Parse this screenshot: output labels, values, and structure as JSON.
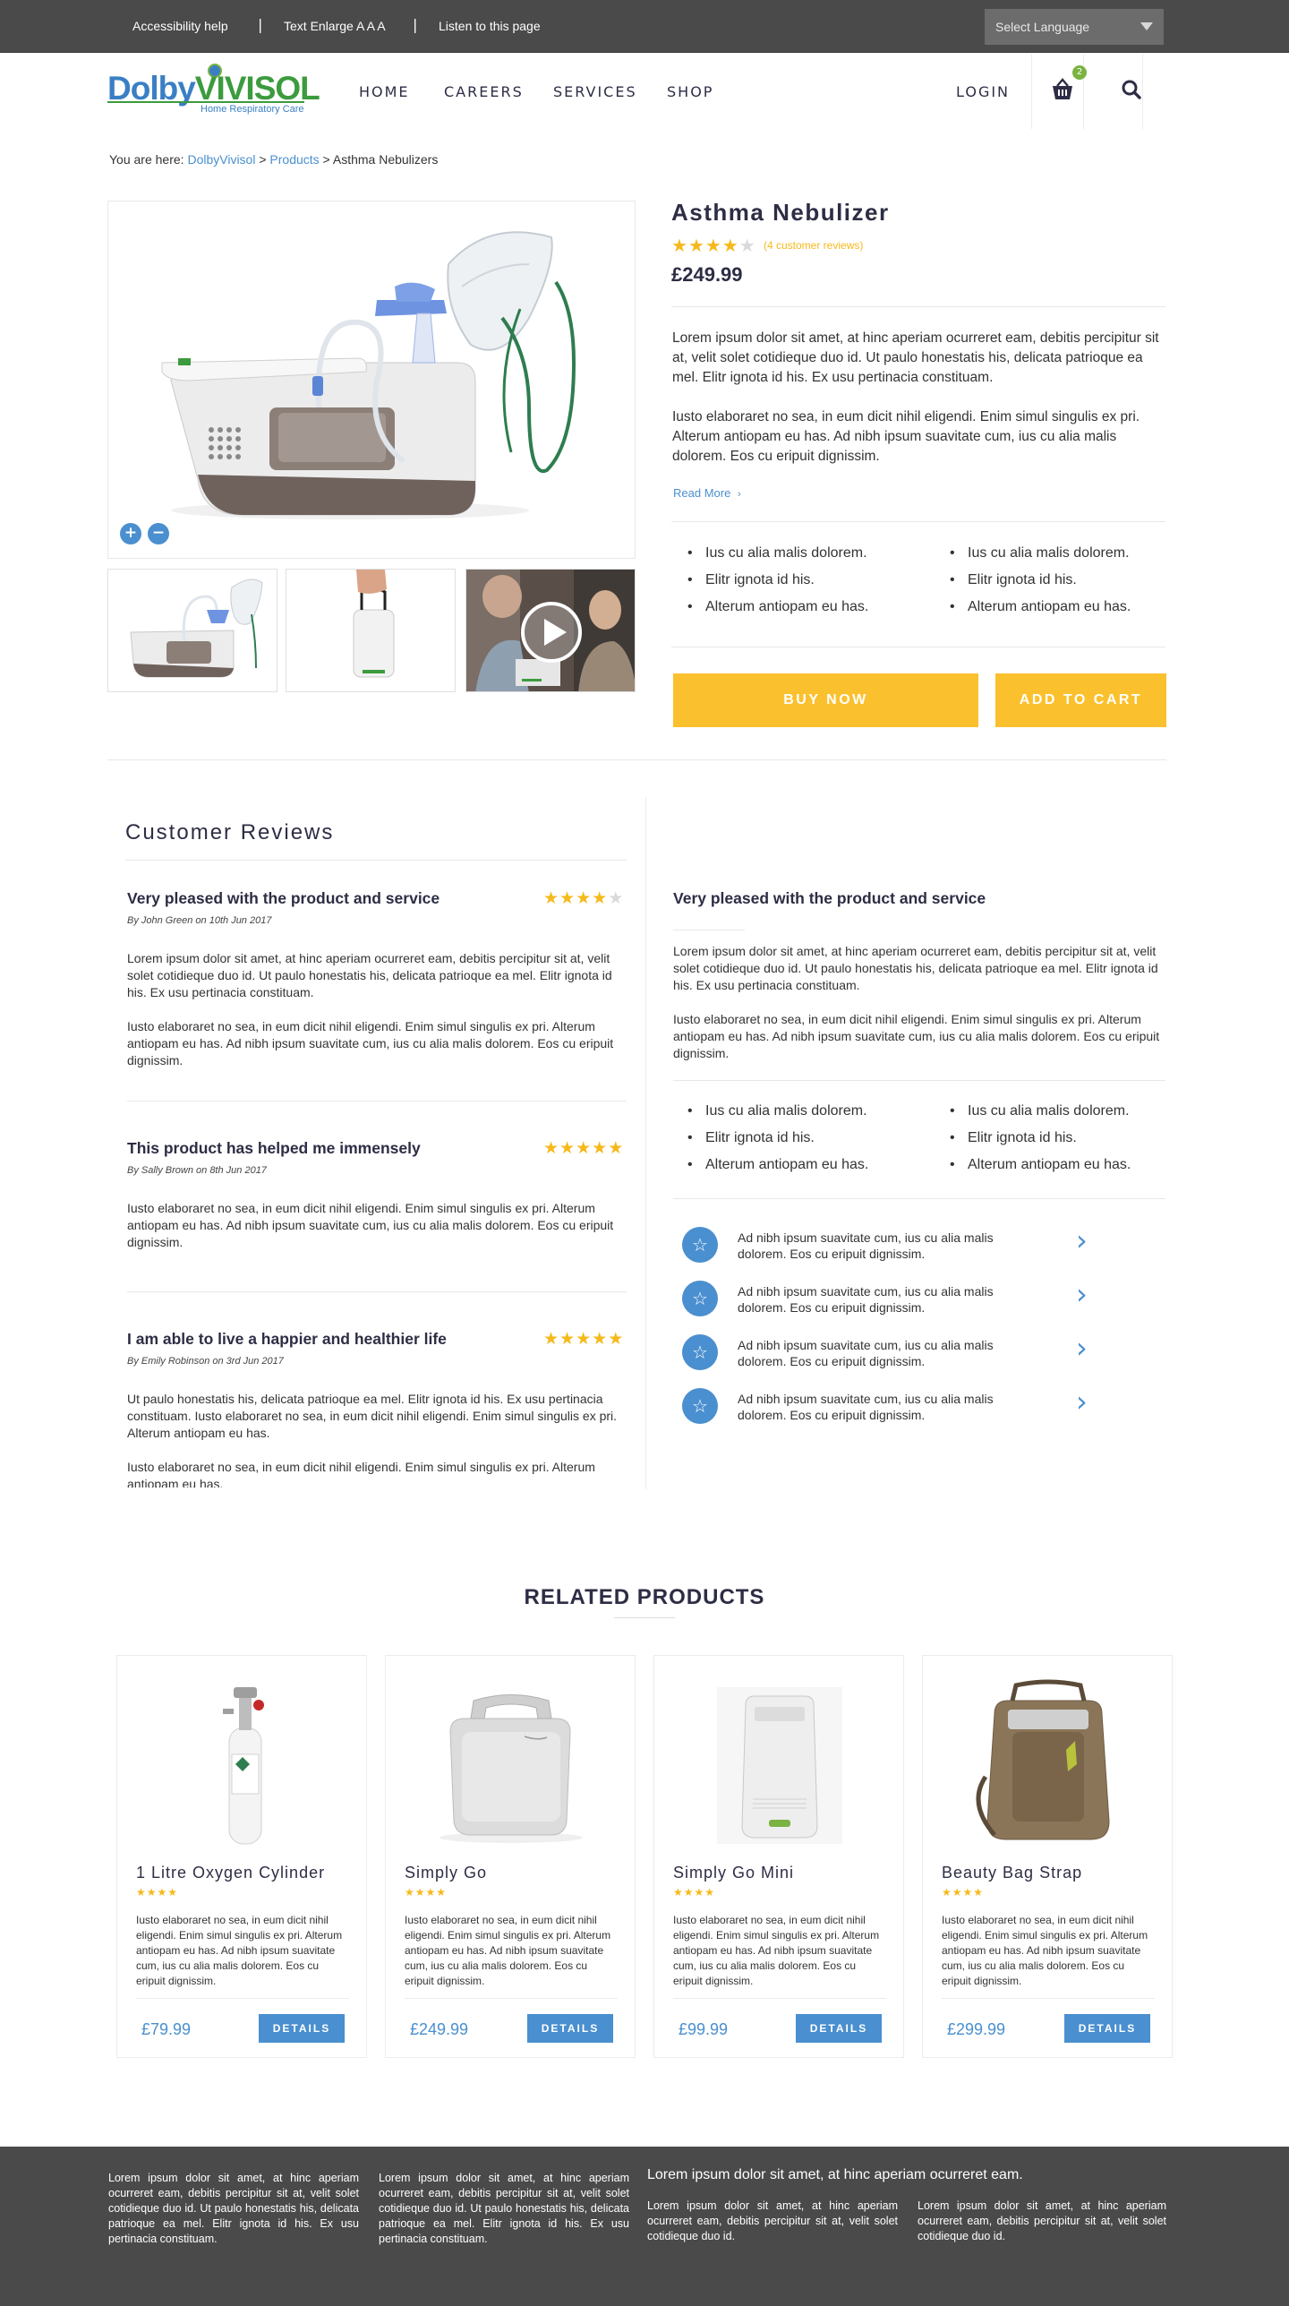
{
  "topbar": {
    "accessibility": "Accessibility help",
    "text_enlarge": "Text Enlarge A A A",
    "listen": "Listen to this page",
    "separator": "|",
    "language": "Select Language"
  },
  "logo": {
    "dolby": "Dolby",
    "vivisol": "VIVISOL",
    "tagline": "Home Respiratory Care"
  },
  "nav": {
    "home": "HOME",
    "careers": "CAREERS",
    "services": "SERVICES",
    "shop": "SHOP",
    "login": "LOGIN",
    "cart_count": "2"
  },
  "breadcrumb": {
    "prefix": "You are here: ",
    "home": "DolbyVivisol",
    "sep": " > ",
    "products": "Products",
    "current": "Asthma Nebulizers"
  },
  "product": {
    "title": "Asthma Nebulizer",
    "rating": 4,
    "reviews_label": "(4 customer reviews)",
    "price": "£249.99",
    "desc1": "Lorem ipsum dolor sit amet, at hinc aperiam ocurreret eam, debitis percipitur sit at, velit solet cotidieque duo id. Ut paulo honestatis his, delicata patrioque ea mel. Elitr ignota id his. Ex usu pertinacia constituam.",
    "desc2": "Iusto elaboraret no sea, in eum dicit nihil eligendi. Enim simul singulis ex pri. Alterum antiopam eu has. Ad nibh ipsum suavitate cum, ius cu alia malis dolorem. Eos cu eripuit dignissim.",
    "read_more": "Read More",
    "bullets_left": [
      "Ius cu alia malis dolorem.",
      "Elitr ignota id his.",
      "Alterum antiopam eu has."
    ],
    "bullets_right": [
      "Ius cu alia malis dolorem.",
      "Elitr ignota id his.",
      "Alterum antiopam eu has."
    ],
    "buy_now": "BUY NOW",
    "add_to_cart": "ADD TO CART",
    "zoom_in": "+",
    "zoom_out": "−"
  },
  "reviews": {
    "title": "Customer Reviews",
    "items": [
      {
        "headline": "Very pleased with the product and service",
        "rating": 4,
        "by": "By John Green on 10th Jun 2017",
        "p1": "Lorem ipsum dolor sit amet, at hinc aperiam ocurreret eam, debitis percipitur sit at, velit solet cotidieque duo id. Ut paulo honestatis his, delicata patrioque ea mel. Elitr ignota id his. Ex usu pertinacia constituam.",
        "p2": "Iusto elaboraret no sea, in eum dicit nihil eligendi. Enim simul singulis ex pri. Alterum antiopam eu has. Ad nibh ipsum suavitate cum, ius cu alia malis dolorem. Eos cu eripuit dignissim."
      },
      {
        "headline": "This product has helped me immensely",
        "rating": 5,
        "by": "By Sally Brown on 8th Jun 2017",
        "p1": "Iusto elaboraret no sea, in eum dicit nihil eligendi. Enim simul singulis ex pri. Alterum antiopam eu has. Ad nibh ipsum suavitate cum, ius cu alia malis dolorem. Eos cu eripuit dignissim."
      },
      {
        "headline": "I am able to live a happier and healthier life",
        "rating": 5,
        "by": "By Emily Robinson on 3rd Jun 2017",
        "p1": "Ut paulo honestatis his, delicata patrioque ea mel. Elitr ignota id his. Ex usu pertinacia constituam. Iusto elaboraret no sea, in eum dicit nihil eligendi. Enim simul singulis ex pri. Alterum antiopam eu has.",
        "p2": "Iusto elaboraret no sea, in eum dicit nihil eligendi. Enim simul singulis ex pri. Alterum antiopam eu has."
      }
    ],
    "right": {
      "headline": "Very pleased with the product and service",
      "p1": "Lorem ipsum dolor sit amet, at hinc aperiam ocurreret eam, debitis percipitur sit at, velit solet cotidieque duo id. Ut paulo honestatis his, delicata patrioque ea mel. Elitr ignota id his. Ex usu pertinacia constituam.",
      "p2": "Iusto elaboraret no sea, in eum dicit nihil eligendi. Enim simul singulis ex pri. Alterum antiopam eu has. Ad nibh ipsum suavitate cum, ius cu alia malis dolorem. Eos cu eripuit dignissim.",
      "bullets_left": [
        "Ius cu alia malis dolorem.",
        "Elitr ignota id his.",
        "Alterum antiopam eu has."
      ],
      "bullets_right": [
        "Ius cu alia malis dolorem.",
        "Elitr ignota id his.",
        "Alterum antiopam eu has."
      ],
      "features": [
        "Ad nibh ipsum suavitate cum, ius cu alia malis dolorem. Eos cu eripuit dignissim.",
        "Ad nibh ipsum suavitate cum, ius cu alia malis dolorem. Eos cu eripuit dignissim.",
        "Ad nibh ipsum suavitate cum, ius cu alia malis dolorem. Eos cu eripuit dignissim.",
        "Ad nibh ipsum suavitate cum, ius cu alia malis dolorem. Eos cu eripuit dignissim."
      ]
    }
  },
  "related": {
    "title": "RELATED PRODUCTS",
    "details_label": "DETAILS",
    "items": [
      {
        "name": "1 Litre Oxygen Cylinder",
        "rating": 4,
        "desc": "Iusto elaboraret no sea, in eum dicit nihil eligendi. Enim simul singulis ex pri. Alterum antiopam eu has. Ad nibh ipsum suavitate cum, ius cu alia malis dolorem. Eos cu eripuit dignissim.",
        "price": "£79.99"
      },
      {
        "name": "Simply Go",
        "rating": 4,
        "desc": "Iusto elaboraret no sea, in eum dicit nihil eligendi. Enim simul singulis ex pri. Alterum antiopam eu has. Ad nibh ipsum suavitate cum, ius cu alia malis dolorem. Eos cu eripuit dignissim.",
        "price": "£249.99"
      },
      {
        "name": "Simply Go Mini",
        "rating": 4,
        "desc": "Iusto elaboraret no sea, in eum dicit nihil eligendi. Enim simul singulis ex pri. Alterum antiopam eu has. Ad nibh ipsum suavitate cum, ius cu alia malis dolorem. Eos cu eripuit dignissim.",
        "price": "£99.99"
      },
      {
        "name": "Beauty Bag Strap",
        "rating": 4,
        "desc": "Iusto elaboraret no sea, in eum dicit nihil eligendi. Enim simul singulis ex pri. Alterum antiopam eu has. Ad nibh ipsum suavitate cum, ius cu alia malis dolorem. Eos cu eripuit dignissim.",
        "price": "£299.99"
      }
    ]
  },
  "footer": {
    "col1": "Lorem ipsum dolor sit amet, at hinc aperiam ocurreret eam, debitis percipitur sit at, velit solet cotidieque duo id. Ut paulo honestatis his, delicata patrioque ea mel. Elitr ignota id his. Ex usu pertinacia constituam.",
    "col2": "Lorem ipsum dolor sit amet, at hinc aperiam ocurreret eam, debitis percipitur sit at, velit solet cotidieque duo id. Ut paulo honestatis his, delicata patrioque ea mel. Elitr ignota id his. Ex usu pertinacia constituam.",
    "heading": "Lorem ipsum dolor sit amet, at hinc aperiam ocurreret eam.",
    "col3": "Lorem ipsum dolor sit amet, at hinc aperiam ocurreret eam, debitis percipitur sit at, velit solet cotidieque duo id.",
    "col4": "Lorem ipsum dolor sit amet, at hinc aperiam ocurreret eam, debitis percipitur sit at, velit solet cotidieque duo id."
  },
  "colors": {
    "accent": "#4a8fcf",
    "cta": "#fbc02d",
    "star": "#f6b91b",
    "dark": "#4a4a4a",
    "heading": "#2d2d45",
    "brand_green": "#3c9b3d"
  },
  "icons": [
    "cart-icon",
    "search-icon",
    "zoom-in-icon",
    "zoom-out-icon",
    "play-icon",
    "star-icon",
    "chevron-right-icon",
    "dropdown-caret-icon"
  ]
}
